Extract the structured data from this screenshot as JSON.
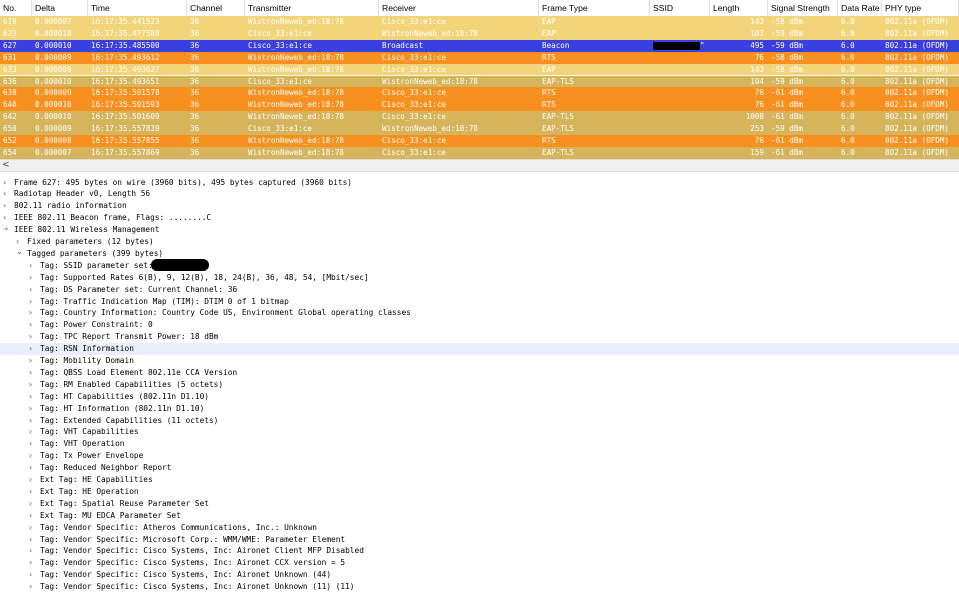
{
  "columns": [
    "No.",
    "Delta",
    "Time",
    "Channel",
    "Transmitter",
    "Receiver",
    "Frame Type",
    "SSID",
    "Length",
    "Signal Strength",
    "Data Rate",
    "PHY type"
  ],
  "packets": [
    {
      "no": "619",
      "delta": "0.000007",
      "time": "16:17:35.441523",
      "channel": "36",
      "transmitter": "WistronNeweb_ed:18:78",
      "receiver": "Cisco_33:e1:ce",
      "frame_type": "EAP",
      "ssid": "",
      "length": "143",
      "signal": "-58 dBm",
      "rate": "6.0",
      "phy": "802.11a (OFDM)",
      "style": "eap"
    },
    {
      "no": "623",
      "delta": "0.000010",
      "time": "16:17:35.477580",
      "channel": "36",
      "transmitter": "Cisco_33:e1:ce",
      "receiver": "WistronNeweb_ed:18:78",
      "frame_type": "EAP",
      "ssid": "",
      "length": "103",
      "signal": "-59 dBm",
      "rate": "6.0",
      "phy": "802.11a (OFDM)",
      "style": "eap"
    },
    {
      "no": "627",
      "delta": "0.000010",
      "time": "16:17:35.485500",
      "channel": "36",
      "transmitter": "Cisco_33:e1:ce",
      "receiver": "Broadcast",
      "frame_type": "Beacon",
      "ssid": "\"",
      "length": "495",
      "signal": "-59 dBm",
      "rate": "6.0",
      "phy": "802.11a (OFDM)",
      "style": "selected"
    },
    {
      "no": "631",
      "delta": "0.000009",
      "time": "16:17:35.493612",
      "channel": "36",
      "transmitter": "WistronNeweb_ed:18:78",
      "receiver": "Cisco_33:e1:ce",
      "frame_type": "RTS",
      "ssid": "",
      "length": "76",
      "signal": "-58 dBm",
      "rate": "6.0",
      "phy": "802.11a (OFDM)",
      "style": "rts"
    },
    {
      "no": "633",
      "delta": "0.000009",
      "time": "16:17:35.493627",
      "channel": "36",
      "transmitter": "WistronNeweb_ed:18:78",
      "receiver": "Cisco_33:e1:ce",
      "frame_type": "EAP",
      "ssid": "",
      "length": "143",
      "signal": "-58 dBm",
      "rate": "6.0",
      "phy": "802.11a (OFDM)",
      "style": "eap"
    },
    {
      "no": "636",
      "delta": "0.000010",
      "time": "16:17:35.493651",
      "channel": "36",
      "transmitter": "Cisco_33:e1:ce",
      "receiver": "WistronNeweb_ed:18:78",
      "frame_type": "EAP-TLS",
      "ssid": "",
      "length": "104",
      "signal": "-59 dBm",
      "rate": "6.0",
      "phy": "802.11a (OFDM)",
      "style": "tls"
    },
    {
      "no": "638",
      "delta": "0.000009",
      "time": "16:17:35.501578",
      "channel": "36",
      "transmitter": "WistronNeweb_ed:18:78",
      "receiver": "Cisco_33:e1:ce",
      "frame_type": "RTS",
      "ssid": "",
      "length": "76",
      "signal": "-61 dBm",
      "rate": "6.0",
      "phy": "802.11a (OFDM)",
      "style": "rts"
    },
    {
      "no": "640",
      "delta": "0.000010",
      "time": "16:17:35.501593",
      "channel": "36",
      "transmitter": "WistronNeweb_ed:18:78",
      "receiver": "Cisco_33:e1:ce",
      "frame_type": "RTS",
      "ssid": "",
      "length": "76",
      "signal": "-61 dBm",
      "rate": "6.0",
      "phy": "802.11a (OFDM)",
      "style": "rts"
    },
    {
      "no": "642",
      "delta": "0.000010",
      "time": "16:17:35.501609",
      "channel": "36",
      "transmitter": "WistronNeweb_ed:18:78",
      "receiver": "Cisco_33:e1:ce",
      "frame_type": "EAP-TLS",
      "ssid": "",
      "length": "1008",
      "signal": "-61 dBm",
      "rate": "6.0",
      "phy": "802.11a (OFDM)",
      "style": "tls"
    },
    {
      "no": "650",
      "delta": "0.000009",
      "time": "16:17:35.557839",
      "channel": "36",
      "transmitter": "Cisco_33:e1:ce",
      "receiver": "WistronNeweb_ed:18:78",
      "frame_type": "EAP-TLS",
      "ssid": "",
      "length": "253",
      "signal": "-59 dBm",
      "rate": "6.0",
      "phy": "802.11a (OFDM)",
      "style": "tls"
    },
    {
      "no": "652",
      "delta": "0.000008",
      "time": "16:17:35.557855",
      "channel": "36",
      "transmitter": "WistronNeweb_ed:18:78",
      "receiver": "Cisco_33:e1:ce",
      "frame_type": "RTS",
      "ssid": "",
      "length": "76",
      "signal": "-61 dBm",
      "rate": "6.0",
      "phy": "802.11a (OFDM)",
      "style": "rts"
    },
    {
      "no": "654",
      "delta": "0.000007",
      "time": "16:17:35.557869",
      "channel": "36",
      "transmitter": "WistronNeweb_ed:18:78",
      "receiver": "Cisco_33:e1:ce",
      "frame_type": "EAP-TLS",
      "ssid": "",
      "length": "159",
      "signal": "-61 dBm",
      "rate": "6.0",
      "phy": "802.11a (OFDM)",
      "style": "tls"
    }
  ],
  "row_colors": {
    "eap": {
      "bg": "#f2d57a",
      "fg": "#ffffff"
    },
    "tls": {
      "bg": "#d6b45c",
      "fg": "#ffffff"
    },
    "rts": {
      "bg": "#f7901e",
      "fg": "#ffffff"
    },
    "selected": {
      "bg": "#3a3fe0",
      "fg": "#ffffff"
    }
  },
  "scroll": {
    "left_arrow": "<"
  },
  "tree": [
    {
      "text": "Frame 627: 495 bytes on wire (3960 bits), 495 bytes captured (3960 bits)",
      "level": 0,
      "state": "collapsed"
    },
    {
      "text": "Radiotap Header v0, Length 56",
      "level": 0,
      "state": "collapsed"
    },
    {
      "text": "802.11 radio information",
      "level": 0,
      "state": "collapsed"
    },
    {
      "text": "IEEE 802.11 Beacon frame, Flags: ........C",
      "level": 0,
      "state": "collapsed"
    },
    {
      "text": "IEEE 802.11 Wireless Management",
      "level": 0,
      "state": "expanded"
    },
    {
      "text": "Fixed parameters (12 bytes)",
      "level": 1,
      "state": "collapsed"
    },
    {
      "text": "Tagged parameters (399 bytes)",
      "level": 1,
      "state": "expanded"
    },
    {
      "text": "Tag: SSID parameter set:",
      "level": 2,
      "state": "collapsed",
      "redacted": true
    },
    {
      "text": "Tag: Supported Rates 6(B), 9, 12(B), 18, 24(B), 36, 48, 54, [Mbit/sec]",
      "level": 2,
      "state": "collapsed"
    },
    {
      "text": "Tag: DS Parameter set: Current Channel: 36",
      "level": 2,
      "state": "collapsed"
    },
    {
      "text": "Tag: Traffic Indication Map (TIM): DTIM 0 of 1 bitmap",
      "level": 2,
      "state": "collapsed"
    },
    {
      "text": "Tag: Country Information: Country Code US, Environment Global operating classes",
      "level": 2,
      "state": "collapsed"
    },
    {
      "text": "Tag: Power Constraint: 0",
      "level": 2,
      "state": "collapsed"
    },
    {
      "text": "Tag: TPC Report Transmit Power: 18 dBm",
      "level": 2,
      "state": "collapsed"
    },
    {
      "text": "Tag: RSN Information",
      "level": 2,
      "state": "collapsed",
      "highlight": true
    },
    {
      "text": "Tag: Mobility Domain",
      "level": 2,
      "state": "collapsed"
    },
    {
      "text": "Tag: QBSS Load Element 802.11e CCA Version",
      "level": 2,
      "state": "collapsed"
    },
    {
      "text": "Tag: RM Enabled Capabilities (5 octets)",
      "level": 2,
      "state": "collapsed"
    },
    {
      "text": "Tag: HT Capabilities (802.11n D1.10)",
      "level": 2,
      "state": "collapsed"
    },
    {
      "text": "Tag: HT Information (802.11n D1.10)",
      "level": 2,
      "state": "collapsed"
    },
    {
      "text": "Tag: Extended Capabilities (11 octets)",
      "level": 2,
      "state": "collapsed"
    },
    {
      "text": "Tag: VHT Capabilities",
      "level": 2,
      "state": "collapsed"
    },
    {
      "text": "Tag: VHT Operation",
      "level": 2,
      "state": "collapsed"
    },
    {
      "text": "Tag: Tx Power Envelope",
      "level": 2,
      "state": "collapsed"
    },
    {
      "text": "Tag: Reduced Neighbor Report",
      "level": 2,
      "state": "collapsed"
    },
    {
      "text": "Ext Tag: HE Capabilities",
      "level": 2,
      "state": "collapsed"
    },
    {
      "text": "Ext Tag: HE Operation",
      "level": 2,
      "state": "collapsed"
    },
    {
      "text": "Ext Tag: Spatial Reuse Parameter Set",
      "level": 2,
      "state": "collapsed"
    },
    {
      "text": "Ext Tag: MU EDCA Parameter Set",
      "level": 2,
      "state": "collapsed"
    },
    {
      "text": "Tag: Vendor Specific: Atheros Communications, Inc.: Unknown",
      "level": 2,
      "state": "collapsed"
    },
    {
      "text": "Tag: Vendor Specific: Microsoft Corp.: WMM/WME: Parameter Element",
      "level": 2,
      "state": "collapsed"
    },
    {
      "text": "Tag: Vendor Specific: Cisco Systems, Inc: Aironet Client MFP Disabled",
      "level": 2,
      "state": "collapsed"
    },
    {
      "text": "Tag: Vendor Specific: Cisco Systems, Inc: Aironet CCX version = 5",
      "level": 2,
      "state": "collapsed"
    },
    {
      "text": "Tag: Vendor Specific: Cisco Systems, Inc: Aironet Unknown (44)",
      "level": 2,
      "state": "collapsed"
    },
    {
      "text": "Tag: Vendor Specific: Cisco Systems, Inc: Aironet Unknown (11) (11)",
      "level": 2,
      "state": "collapsed"
    }
  ],
  "expander_icons": {
    "collapsed": "›",
    "expanded": "⌄"
  }
}
